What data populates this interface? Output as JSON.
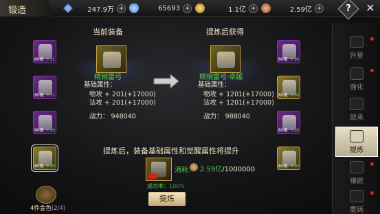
{
  "header": {
    "title": "锻造",
    "resources": [
      {
        "icon": "blue-crystal-icon",
        "value": "247.9万",
        "color": "#4a8ce0"
      },
      {
        "icon": "blue-gem-icon",
        "value": "65693",
        "color": "#5fa8f0"
      },
      {
        "icon": "gold-coin-icon",
        "value": "1.1亿",
        "color": "#e0b040"
      },
      {
        "icon": "copper-coin-icon",
        "value": "2.59亿",
        "color": "#d08a55"
      }
    ],
    "help_label": "?",
    "close_label": "✕"
  },
  "side_tabs": [
    {
      "label": "升星",
      "icon": "star-upgrade-icon",
      "active": false,
      "red_dot": true
    },
    {
      "label": "强化",
      "icon": "enhance-icon",
      "active": false,
      "red_dot": true
    },
    {
      "label": "继承",
      "icon": "inherit-icon",
      "active": false,
      "red_dot": false
    },
    {
      "label": "提炼",
      "icon": "refine-icon",
      "active": true,
      "red_dot": false
    },
    {
      "label": "镶嵌",
      "icon": "inlay-icon",
      "active": false,
      "red_dot": true
    },
    {
      "label": "重铸",
      "icon": "recast-icon",
      "active": false,
      "red_dot": true
    }
  ],
  "left_slots": [
    {
      "level": "80级",
      "plus": "+11"
    },
    {
      "level": "80级",
      "plus": "+11"
    },
    {
      "level": "80级",
      "plus": "+10"
    },
    {
      "level": "80级",
      "plus": "+10"
    }
  ],
  "right_slots": [
    {
      "level": "80级",
      "plus": "+10"
    },
    {
      "level": "80级",
      "plus": "+10"
    },
    {
      "level": "80级",
      "plus": "+10"
    },
    {
      "level": "80级",
      "plus": "+10"
    }
  ],
  "current": {
    "header": "当前装备",
    "item_name": "精钢雷弓",
    "base_label": "基础属性：",
    "stats": [
      "物攻 + 201(+17000)",
      "法攻 + 201(+17000)"
    ],
    "power": "战力： 948040"
  },
  "after": {
    "header": "提炼后获得",
    "item_name": "精钢雷弓·卓越",
    "base_label": "基础属性：",
    "stats": [
      "物攻 + 1201(+17000)",
      "法攻 + 1201(+17000)"
    ],
    "power": "战力： 988040"
  },
  "notice": "提炼后，装备基础属性和觉醒属性将提升",
  "cost": {
    "label": "消耗：",
    "have": "2.59亿",
    "need": "/1000000"
  },
  "success": {
    "label": "成功率：",
    "value": "100%"
  },
  "refine_button": "提炼",
  "set_bonus": {
    "label": "4件金色",
    "count": "(2/4)"
  }
}
